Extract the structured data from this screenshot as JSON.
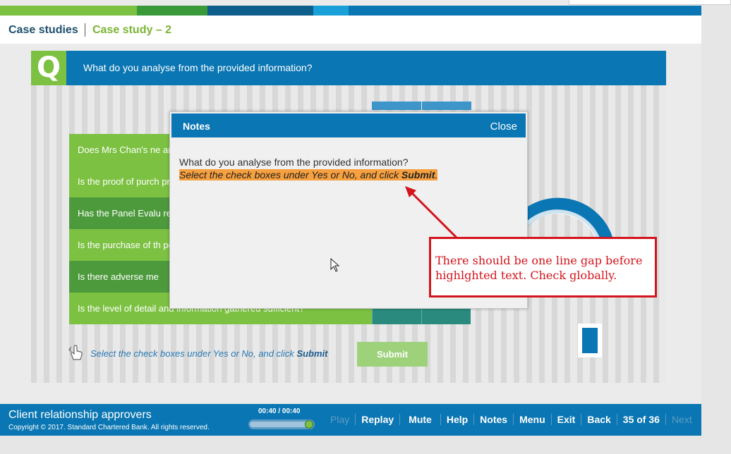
{
  "topbar": {
    "segments": [
      "#7cc142",
      "#3a9a3a",
      "#0d5e8a",
      "#1aa0d8",
      "#0a76b3"
    ]
  },
  "breadcrumb": {
    "root": "Case studies",
    "current": "Case study – 2"
  },
  "question": {
    "badge": "Q",
    "text": "What do you analyse from the provided information?"
  },
  "checklist": {
    "rows": [
      {
        "text": "Does Mrs Chan's ne and lifestyle?"
      },
      {
        "text": "Is the proof of purch provided by Mrs Cha"
      },
      {
        "text": "Has the Panel Evalu reasonable?"
      },
      {
        "text": "Is the purchase of th position?"
      },
      {
        "text": "Is there adverse me"
      },
      {
        "text": "Is the level of detail and information gathered sufficient?"
      }
    ]
  },
  "hint": {
    "prefix": "Select the check boxes under Yes or No, and click ",
    "emph": "Submit"
  },
  "submit": {
    "label": "Submit"
  },
  "modal": {
    "title": "Notes",
    "close": "Close",
    "line1": "What do you analyse from the provided information?",
    "highlight_prefix": "Select the check boxes under Yes or No, and click ",
    "highlight_emph": "Submit",
    "highlight_suffix": "."
  },
  "annotation": {
    "text": "There should be one line gap before highlghted text. Check globally."
  },
  "footer": {
    "title": "Client relationship approvers",
    "copyright": "Copyright © 2017. Standard Chartered Bank. All rights reserved.",
    "time": "00:40 / 00:40",
    "progress": 1.0,
    "nav": {
      "play": "Play",
      "replay": "Replay",
      "mute": "Mute",
      "help": "Help",
      "notes": "Notes",
      "menu": "Menu",
      "exit": "Exit",
      "back": "Back",
      "page": "35 of 36",
      "next": "Next"
    }
  },
  "colors": {
    "brand_blue": "#0a76b3",
    "brand_green": "#7cc142",
    "highlight": "#f7a03f",
    "annotation_red": "#d4141c"
  }
}
